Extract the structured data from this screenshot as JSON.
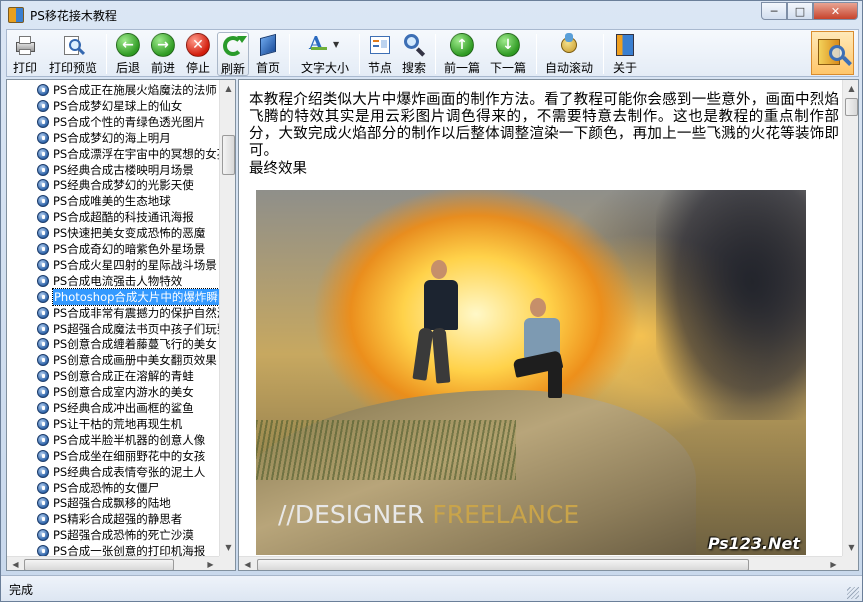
{
  "window": {
    "title": "PS移花接木教程"
  },
  "toolbar": {
    "print": "打印",
    "print_preview": "打印预览",
    "back": "后退",
    "forward": "前进",
    "stop": "停止",
    "refresh": "刷新",
    "home": "首页",
    "font_size": "文字大小",
    "nodes": "节点",
    "search": "搜索",
    "prev": "前一篇",
    "next": "下一篇",
    "autoscroll": "自动滚动",
    "about": "关于"
  },
  "tree": {
    "items": [
      "PS合成正在施展火焰魔法的法师",
      "PS合成梦幻星球上的仙女",
      "PS合成个性的青绿色透光图片",
      "PS合成梦幻的海上明月",
      "PS合成漂浮在宇宙中的冥想的女孩",
      "PS经典合成古楼映明月场景",
      "PS经典合成梦幻的光影天使",
      "PS合成唯美的生态地球",
      "PS合成超酷的科技通讯海报",
      "PS快速把美女变成恐怖的恶魔",
      "PS合成奇幻的暗紫色外星场景",
      "PS合成火星四射的星际战斗场景",
      "PS合成电流强击人物特效",
      "Photoshop合成大片中的爆炸瞬间",
      "PS合成非常有震撼力的保护自然海报",
      "PS超强合成魔法书页中孩子们玩耍",
      "PS创意合成缠着藤蔓飞行的美女",
      "PS创意合成画册中美女翻页效果",
      "PS创意合成正在溶解的青蛙",
      "PS创意合成室内游水的美女",
      "PS经典合成冲出画框的鲨鱼",
      "PS让干枯的荒地再现生机",
      "PS合成半脸半机器的创意人像",
      "PS合成坐在细丽野花中的女孩",
      "PS经典合成表情夸张的泥土人",
      "PS合成恐怖的女僵尸",
      "PS超强合成飘移的陆地",
      "PS精彩合成超强的静思者",
      "PS超强合成恐怖的死亡沙漠",
      "PS合成一张创意的打印机海报"
    ],
    "selected_index": 13
  },
  "article": {
    "intro": "本教程介绍类似大片中爆炸画面的制作方法。看了教程可能你会感到一些意外，画面中烈焰飞腾的特效其实是用云彩图片调色得来的，不需要特意去制作。这也是教程的重点制作部分，大致完成火焰部分的制作以后整体调整渲染一下颜色，再加上一些飞溅的火花等装饰即可。",
    "final_label": "最终效果",
    "image_text_1": "//DESIGNER ",
    "image_text_2": "FREELANCE",
    "watermark": "Ps123.Net"
  },
  "status": {
    "text": "完成"
  }
}
